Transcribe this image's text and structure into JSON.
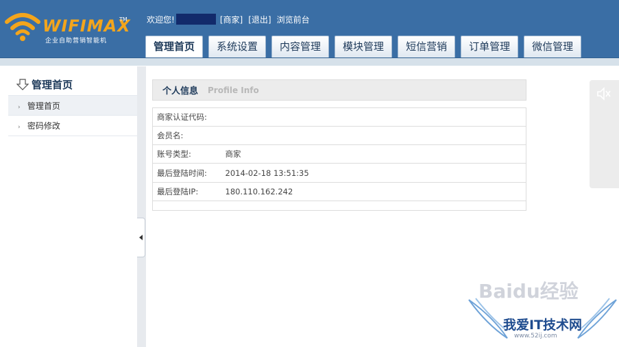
{
  "logo": {
    "text": "WIFIMAX",
    "tm": "TM",
    "subtitle": "企业自助营销智能机"
  },
  "topbar": {
    "welcome": "欢迎您!",
    "bracket_open": "[",
    "bracket_close": "]",
    "merchant_link": "商家",
    "logout_link": "退出",
    "frontend_link": "浏览前台"
  },
  "nav": {
    "tabs": [
      {
        "label": "管理首页"
      },
      {
        "label": "系统设置"
      },
      {
        "label": "内容管理"
      },
      {
        "label": "模块管理"
      },
      {
        "label": "短信营销"
      },
      {
        "label": "订单管理"
      },
      {
        "label": "微信管理"
      }
    ]
  },
  "sidebar": {
    "title": "管理首页",
    "items": [
      {
        "label": "管理首页"
      },
      {
        "label": "密码修改"
      }
    ]
  },
  "panel": {
    "title_cn": "个人信息",
    "title_en": "Profile  Info",
    "rows": [
      {
        "label": "商家认证代码:",
        "value": ""
      },
      {
        "label": "会员名:",
        "value": ""
      },
      {
        "label": "账号类型:",
        "value": "商家"
      },
      {
        "label": "最后登陆时间:",
        "value": "2014-02-18 13:51:35"
      },
      {
        "label": "最后登陆IP:",
        "value": "180.110.162.242"
      }
    ]
  },
  "watermark": {
    "baidu": "Baidu经验",
    "main": "我爱IT技术网",
    "url": "www.52ij.com"
  },
  "colors": {
    "header_blue": "#3a6ea5",
    "logo_orange": "#f3a51c",
    "nav_text": "#1e3a5a",
    "panel_bg": "#ececec"
  }
}
